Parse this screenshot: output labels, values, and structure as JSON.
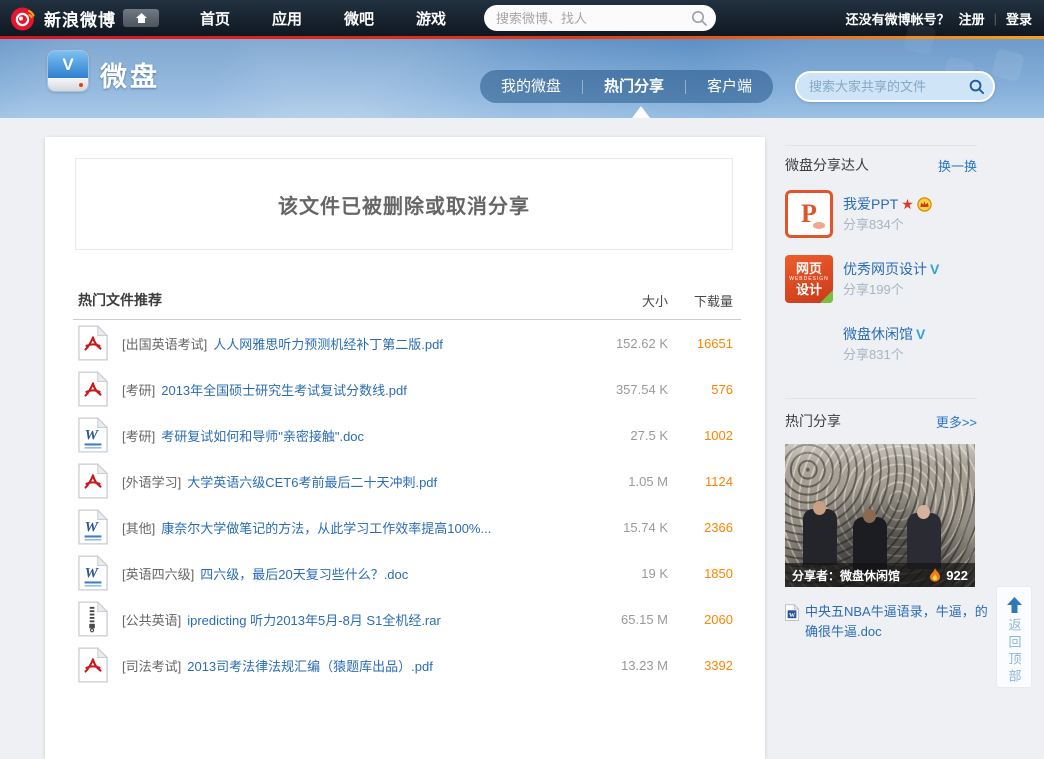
{
  "topbar": {
    "brand": "新浪微博",
    "nav_items": [
      "首页",
      "应用",
      "微吧",
      "游戏"
    ],
    "search_placeholder": "搜索微博、找人",
    "account": {
      "prompt": "还没有微博帐号？",
      "register": "注册",
      "separator": "|",
      "login": "登录"
    }
  },
  "banner": {
    "app_name": "微盘",
    "logo_letter": "V",
    "tabs": [
      {
        "label": "我的微盘"
      },
      {
        "label": "热门分享"
      },
      {
        "label": "客户端"
      }
    ],
    "search_placeholder": "搜索大家共享的文件"
  },
  "notice": {
    "message": "该文件已被删除或取消分享"
  },
  "file_list": {
    "title": "热门文件推荐",
    "columns": {
      "size": "大小",
      "downloads": "下载量"
    },
    "rows": [
      {
        "type": "pdf",
        "category": "[出国英语考试]",
        "name": "人人网雅思听力预测机经补丁第二版.pdf",
        "size": "152.62 K",
        "downloads": "16651"
      },
      {
        "type": "pdf",
        "category": "[考研]",
        "name": "2013年全国硕士研究生考试复试分数线.pdf",
        "size": "357.54 K",
        "downloads": "576"
      },
      {
        "type": "doc",
        "category": "[考研]",
        "name": "考研复试如何和导师\"亲密接触\".doc",
        "size": "27.5 K",
        "downloads": "1002"
      },
      {
        "type": "pdf",
        "category": "[外语学习]",
        "name": "大学英语六级CET6考前最后二十天冲刺.pdf",
        "size": "1.05 M",
        "downloads": "1124"
      },
      {
        "type": "doc",
        "category": "[其他]",
        "name": "康奈尔大学做笔记的方法，从此学习工作效率提高100%...",
        "size": "15.74 K",
        "downloads": "2366"
      },
      {
        "type": "doc",
        "category": "[英语四六级]",
        "name": "四六级，最后20天复习些什么？.doc",
        "size": "19 K",
        "downloads": "1850"
      },
      {
        "type": "rar",
        "category": "[公共英语]",
        "name": "ipredicting 听力2013年5月-8月 S1全机经.rar",
        "size": "65.15 M",
        "downloads": "2060"
      },
      {
        "type": "pdf",
        "category": "[司法考试]",
        "name": "2013司考法律法规汇编（猿题库出品）.pdf",
        "size": "13.23 M",
        "downloads": "3392"
      }
    ]
  },
  "sidebar": {
    "experts": {
      "title": "微盘分享达人",
      "switch_label": "换一换",
      "star_glyph": "★",
      "verified_glyph": "V",
      "users": [
        {
          "name": "我爱PPT",
          "shares": "分享834个",
          "avatar_letter": "P"
        },
        {
          "name": "优秀网页设计",
          "shares": "分享199个",
          "avatar_lines": [
            "网页",
            "WEBDESIGN",
            "设计"
          ]
        },
        {
          "name": "微盘休闲馆",
          "shares": "分享831个"
        }
      ]
    },
    "hot": {
      "title": "热门分享",
      "more_label": "更多>>",
      "image_caption": "分享者：微盘休闲馆",
      "hot_count": "922",
      "doc_name": "中央五NBA牛逼语录，牛逼，的确很牛逼.doc"
    }
  },
  "back_to_top": {
    "label": "返回顶部"
  },
  "colors": {
    "brand_red": "#e6162d",
    "accent_orange": "#ff8400",
    "link_blue": "#2a6cb5",
    "banner_blue": "#5d95cc"
  }
}
